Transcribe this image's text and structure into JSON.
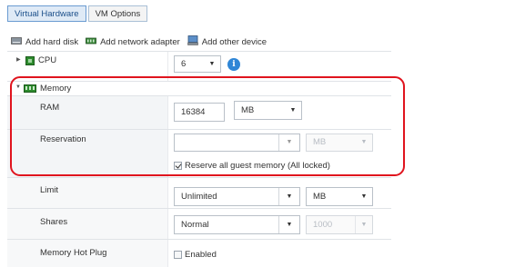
{
  "tabs": [
    {
      "label": "Virtual Hardware"
    },
    {
      "label": "VM Options"
    }
  ],
  "toolbar": {
    "add_hard_disk": "Add hard disk",
    "add_network_adapter": "Add network adapter",
    "add_other_device": "Add other device"
  },
  "cpu": {
    "label": "CPU",
    "value": "6",
    "info_glyph": "i"
  },
  "memory": {
    "label": "Memory",
    "ram": {
      "label": "RAM",
      "value": "16384",
      "unit": "MB"
    },
    "reservation": {
      "label": "Reservation",
      "value": "",
      "unit": "MB",
      "reserve_all_label": "Reserve all guest memory (All locked)",
      "reserve_all_checked": true
    },
    "limit": {
      "label": "Limit",
      "value": "Unlimited",
      "unit": "MB"
    },
    "shares": {
      "label": "Shares",
      "value": "Normal",
      "amount": "1000"
    },
    "hot_plug": {
      "label": "Memory Hot Plug",
      "checkbox_label": "Enabled",
      "checked": false
    }
  },
  "icons": {
    "expand_collapsed": "triangle-right",
    "expand_open": "triangle-down",
    "dropdown": "▼"
  },
  "colors": {
    "highlight": "#e0141e",
    "tab_active_bg": "#dfeaf6",
    "info_blue": "#2f86d6",
    "cpu_icon": "#2e8b2e"
  }
}
